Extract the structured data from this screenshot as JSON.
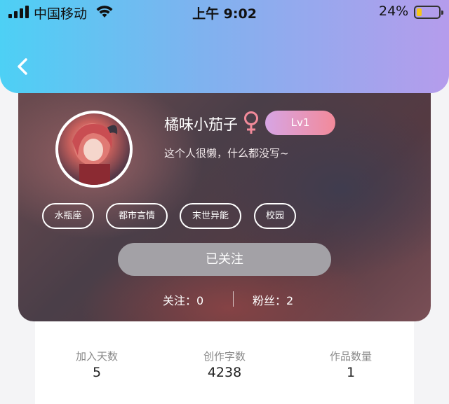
{
  "status_bar": {
    "carrier": "中国移动",
    "time": "上午 9:02",
    "battery_percent": "24%",
    "battery_level": 0.24,
    "battery_color": "#f5c518"
  },
  "header": {
    "back_icon": "chevron-left-icon",
    "gradient": [
      "#4dd0f5",
      "#b59cec"
    ]
  },
  "profile": {
    "username": "橘味小茄子",
    "gender_icon": "female-icon",
    "gender_color": "#f28a9a",
    "level": "Lv1",
    "bio": "这个人很懒，什么都没写~",
    "tags": [
      "水瓶座",
      "都市言情",
      "末世异能",
      "校园"
    ],
    "follow_button": "已关注",
    "following": "关注：0",
    "fans": "粉丝：2"
  },
  "stats": [
    {
      "label": "加入天数",
      "value": "5"
    },
    {
      "label": "创作字数",
      "value": "4238"
    },
    {
      "label": "作品数量",
      "value": "1"
    }
  ]
}
